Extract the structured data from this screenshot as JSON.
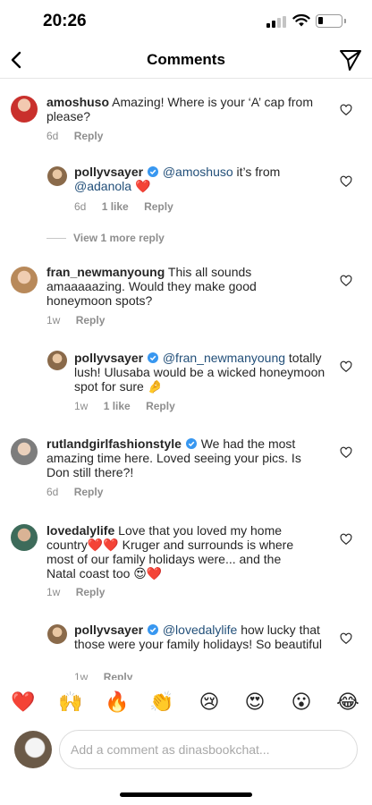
{
  "status_bar": {
    "time": "20:26"
  },
  "header": {
    "title": "Comments"
  },
  "comments": [
    {
      "username": "amoshuso",
      "text": "Amazing! Where is your ‘A’ cap from please?",
      "time": "6d",
      "reply": "Reply",
      "replies": [
        {
          "username": "pollyvsayer",
          "mention": "@amoshuso",
          "text_mid": " it’s from ",
          "mention2": "@adanola",
          "emoji": "❤️",
          "time": "6d",
          "likes": "1 like",
          "reply": "Reply"
        }
      ],
      "view_more": "View 1 more reply"
    },
    {
      "username": "fran_newmanyoung",
      "text": "This all sounds amaaaaazing. Would they make good honeymoon spots?",
      "time": "1w",
      "reply": "Reply",
      "replies": [
        {
          "username": "pollyvsayer",
          "mention": "@fran_newmanyoung",
          "text": " totally lush! Ulusaba would be a wicked honeymoon spot for sure",
          "emoji": "🤌",
          "time": "1w",
          "likes": "1 like",
          "reply": "Reply"
        }
      ]
    },
    {
      "username": "rutlandgirlfashionstyle",
      "text": "We had the most amazing time here. Loved seeing your pics. Is Don still there?!",
      "time": "6d",
      "reply": "Reply"
    },
    {
      "username": "lovedalylife",
      "text1": "Love that you loved my home country",
      "emoji1": "❤️❤️",
      "text2": " Kruger and surrounds is where most of our family holidays were... and the Natal coast too ",
      "emoji2": "😍❤️",
      "time": "1w",
      "reply": "Reply",
      "replies": [
        {
          "username": "pollyvsayer",
          "mention": "@lovedalylife",
          "text": " how lucky that those were your family holidays! So beautiful",
          "time": "1w",
          "reply": "Reply"
        }
      ]
    }
  ],
  "emoji_bar": [
    "❤️",
    "🙌",
    "🔥",
    "👏",
    "😢",
    "😍",
    "😮",
    "😂"
  ],
  "composer": {
    "placeholder": "Add a comment as dinasbookchat..."
  },
  "colors": {
    "verified": "#3897f0",
    "mention": "#224f79",
    "meta": "#8e8e8e",
    "heart_red": "#ed4956"
  }
}
